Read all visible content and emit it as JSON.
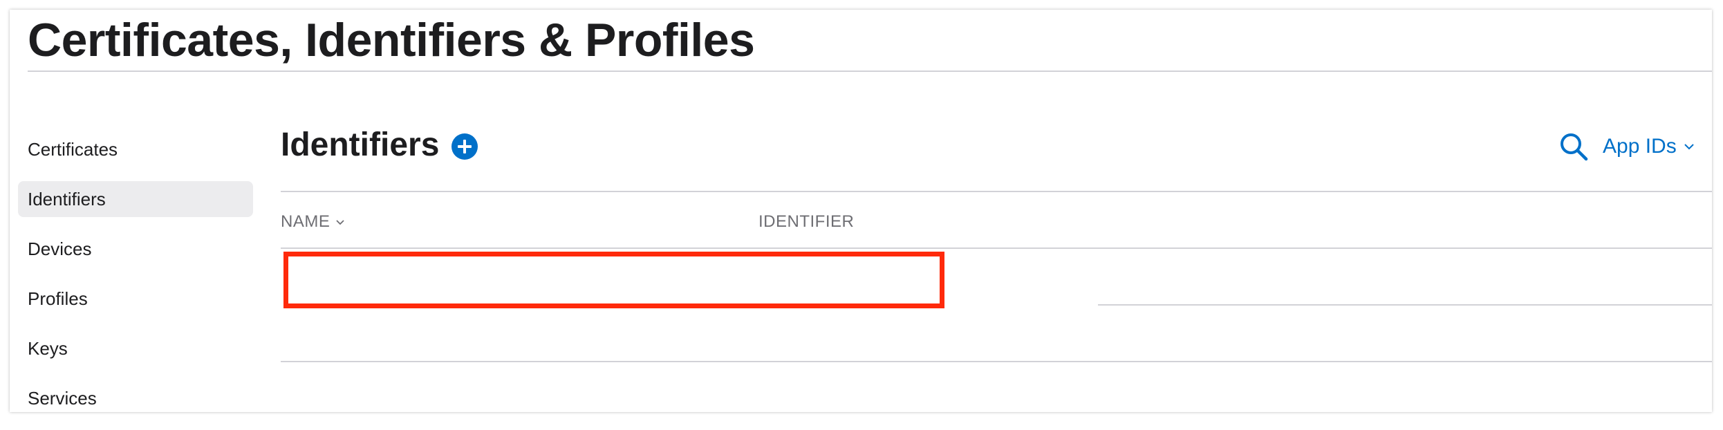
{
  "header": {
    "title": "Certificates, Identifiers & Profiles"
  },
  "sidebar": {
    "items": [
      {
        "label": "Certificates",
        "active": false
      },
      {
        "label": "Identifiers",
        "active": true
      },
      {
        "label": "Devices",
        "active": false
      },
      {
        "label": "Profiles",
        "active": false
      },
      {
        "label": "Keys",
        "active": false
      },
      {
        "label": "Services",
        "active": false
      }
    ]
  },
  "main": {
    "title": "Identifiers",
    "add_icon": "plus-circle-icon",
    "search_icon": "search-icon",
    "filter_label": "App IDs",
    "table": {
      "columns": [
        "NAME",
        "IDENTIFIER"
      ],
      "rows": []
    }
  },
  "colors": {
    "accent": "#0070c9",
    "highlight": "#ff2a0b",
    "active_bg": "#ececee",
    "rule": "#d2d2d7"
  }
}
